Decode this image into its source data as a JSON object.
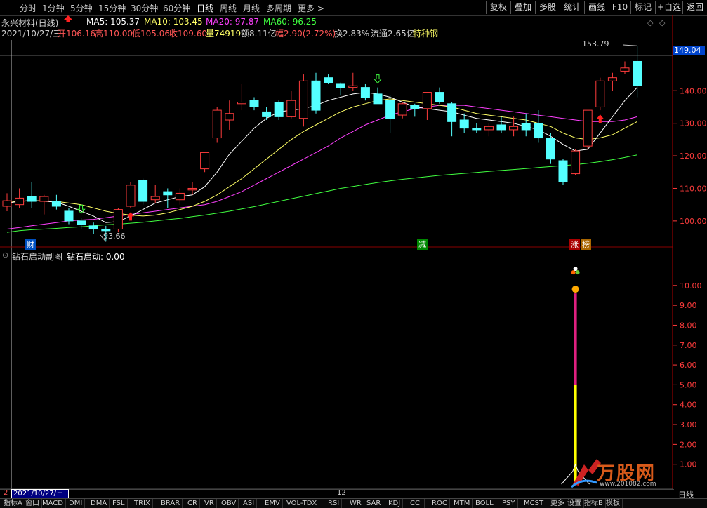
{
  "toolbar": {
    "periods": [
      "分时",
      "1分钟",
      "5分钟",
      "15分钟",
      "30分钟",
      "60分钟",
      "日线",
      "周线",
      "月线",
      "多周期",
      "更多 >"
    ],
    "active_period": "日线",
    "right_buttons": [
      "复权",
      "叠加",
      "多股",
      "统计",
      "画线",
      "F10",
      "标记",
      "+自选",
      "返回"
    ]
  },
  "header": {
    "stock": "永兴材料(日线)",
    "ma5": "MA5: 105.37",
    "ma10": "MA10: 103.45",
    "ma20": "MA20: 97.87",
    "ma60": "MA60: 96.25"
  },
  "quote": {
    "date": "2021/10/27/三",
    "open": "开106.16",
    "high": "高110.00",
    "low": "低105.06",
    "close": "收109.60",
    "volume": "量74919",
    "amount": "额8.11亿",
    "change": "幅2.90(2.72%)",
    "turnover": "换2.83%",
    "float": "流通2.65亿",
    "tag": "特种钢"
  },
  "labels": {
    "high_mark": "153.79",
    "low_mark": "93.66",
    "price_box": "149.04",
    "event_cai": "财",
    "event_jian": "减",
    "event_zhang": "涨",
    "event_bang": "榜",
    "sub_title": "钻石启动副图",
    "sub_value": "钻石启动: 0.00",
    "date_box": "2021/10/27/三",
    "date_mark_left": "2",
    "date_mark_mid": "12",
    "daily_label": "日线",
    "watermark": "万股网",
    "watermark_url": "www.201082.com"
  },
  "bottom_tabs": [
    "指标A",
    "窗口",
    "MACD",
    "DMI",
    "DMA",
    "FSL",
    "TRIX",
    "BRAR",
    "CR",
    "VR",
    "OBV",
    "ASI",
    "EMV",
    "VOL-TDX",
    "RSI",
    "WR",
    "SAR",
    "KDJ",
    "CCI",
    "ROC",
    "MTM",
    "BOLL",
    "PSY",
    "MCST",
    "更多",
    "设置",
    "指标B",
    "模板"
  ],
  "colors": {
    "up": "#ff3c3c",
    "down": "#54ffff",
    "ma5": "#ffffff",
    "ma10": "#ffff66",
    "ma20": "#ff40ff",
    "ma60": "#40ff40",
    "axis": "#ff3c3c"
  },
  "chart_data": [
    {
      "type": "candlestick",
      "y_ticks": [
        100.0,
        110.0,
        120.0,
        130.0,
        140.0
      ],
      "ylim": [
        92,
        156
      ],
      "candles": [
        {
          "o": 104.5,
          "h": 108.5,
          "l": 103.0,
          "c": 106.2
        },
        {
          "o": 105.0,
          "h": 110.0,
          "l": 104.0,
          "c": 107.0
        },
        {
          "o": 107.5,
          "h": 112.0,
          "l": 104.0,
          "c": 106.0
        },
        {
          "o": 106.0,
          "h": 108.0,
          "l": 102.0,
          "c": 107.5
        },
        {
          "o": 106.0,
          "h": 108.0,
          "l": 103.5,
          "c": 104.5
        },
        {
          "o": 103.0,
          "h": 104.0,
          "l": 99.0,
          "c": 100.0
        },
        {
          "o": 100.0,
          "h": 101.0,
          "l": 97.5,
          "c": 99.0
        },
        {
          "o": 98.5,
          "h": 99.5,
          "l": 96.0,
          "c": 97.5
        },
        {
          "o": 97.5,
          "h": 98.5,
          "l": 93.66,
          "c": 97.0
        },
        {
          "o": 97.5,
          "h": 104.0,
          "l": 96.5,
          "c": 103.5
        },
        {
          "o": 104.5,
          "h": 112.0,
          "l": 104.0,
          "c": 111.0
        },
        {
          "o": 112.5,
          "h": 113.0,
          "l": 105.0,
          "c": 106.0
        },
        {
          "o": 106.5,
          "h": 111.0,
          "l": 105.5,
          "c": 107.5
        },
        {
          "o": 109.0,
          "h": 110.0,
          "l": 104.0,
          "c": 108.0
        },
        {
          "o": 106.5,
          "h": 110.0,
          "l": 105.0,
          "c": 108.5
        },
        {
          "o": 109.5,
          "h": 112.0,
          "l": 108.0,
          "c": 110.0
        },
        {
          "o": 116.0,
          "h": 121.0,
          "l": 115.0,
          "c": 121.0
        },
        {
          "o": 125.5,
          "h": 135.0,
          "l": 124.0,
          "c": 134.0
        },
        {
          "o": 131.0,
          "h": 137.0,
          "l": 128.0,
          "c": 133.0
        },
        {
          "o": 136.0,
          "h": 142.0,
          "l": 134.0,
          "c": 136.5
        },
        {
          "o": 137.0,
          "h": 138.0,
          "l": 134.0,
          "c": 135.0
        },
        {
          "o": 133.5,
          "h": 135.0,
          "l": 131.0,
          "c": 132.0
        },
        {
          "o": 136.5,
          "h": 137.0,
          "l": 131.0,
          "c": 132.0
        },
        {
          "o": 132.0,
          "h": 140.0,
          "l": 131.5,
          "c": 137.0
        },
        {
          "o": 131.5,
          "h": 145.0,
          "l": 129.0,
          "c": 143.0
        },
        {
          "o": 143.0,
          "h": 145.5,
          "l": 133.0,
          "c": 134.0
        },
        {
          "o": 144.0,
          "h": 145.0,
          "l": 142.0,
          "c": 142.5
        },
        {
          "o": 142.0,
          "h": 142.5,
          "l": 138.5,
          "c": 141.0
        },
        {
          "o": 141.0,
          "h": 145.5,
          "l": 140.0,
          "c": 141.5
        },
        {
          "o": 141.0,
          "h": 142.0,
          "l": 137.0,
          "c": 138.0
        },
        {
          "o": 139.0,
          "h": 141.0,
          "l": 136.0,
          "c": 136.0
        },
        {
          "o": 137.0,
          "h": 138.5,
          "l": 127.0,
          "c": 131.5
        },
        {
          "o": 132.5,
          "h": 136.5,
          "l": 131.5,
          "c": 136.0
        },
        {
          "o": 135.5,
          "h": 136.0,
          "l": 132.0,
          "c": 134.5
        },
        {
          "o": 134.5,
          "h": 137.5,
          "l": 131.0,
          "c": 139.5
        },
        {
          "o": 139.5,
          "h": 141.0,
          "l": 136.0,
          "c": 136.5
        },
        {
          "o": 136.0,
          "h": 136.5,
          "l": 126.0,
          "c": 130.5
        },
        {
          "o": 131.0,
          "h": 133.0,
          "l": 127.0,
          "c": 128.5
        },
        {
          "o": 128.5,
          "h": 130.0,
          "l": 127.0,
          "c": 128.0
        },
        {
          "o": 128.0,
          "h": 130.0,
          "l": 126.0,
          "c": 129.0
        },
        {
          "o": 129.5,
          "h": 132.0,
          "l": 127.0,
          "c": 128.0
        },
        {
          "o": 128.0,
          "h": 132.0,
          "l": 126.0,
          "c": 129.0
        },
        {
          "o": 130.0,
          "h": 133.0,
          "l": 126.0,
          "c": 128.0
        },
        {
          "o": 130.0,
          "h": 134.0,
          "l": 124.0,
          "c": 125.5
        },
        {
          "o": 125.5,
          "h": 127.0,
          "l": 117.5,
          "c": 119.0
        },
        {
          "o": 118.5,
          "h": 119.0,
          "l": 111.0,
          "c": 112.0
        },
        {
          "o": 114.5,
          "h": 122.0,
          "l": 114.0,
          "c": 121.5
        },
        {
          "o": 123.0,
          "h": 134.0,
          "l": 122.0,
          "c": 134.0
        },
        {
          "o": 135.0,
          "h": 144.0,
          "l": 134.0,
          "c": 143.0
        },
        {
          "o": 143.0,
          "h": 145.5,
          "l": 140.0,
          "c": 144.0
        },
        {
          "o": 146.0,
          "h": 149.0,
          "l": 145.0,
          "c": 147.0
        },
        {
          "o": 149.0,
          "h": 153.79,
          "l": 138.0,
          "c": 141.5
        }
      ],
      "ma5": [
        105.5,
        106.0,
        106.3,
        106.0,
        105.8,
        104.5,
        103.0,
        101.5,
        99.5,
        99.8,
        101.5,
        103.5,
        105.5,
        106.5,
        107.5,
        108.0,
        110.5,
        115.0,
        120.5,
        124.5,
        128.5,
        131.5,
        133.5,
        134.0,
        134.5,
        135.5,
        137.0,
        138.0,
        139.0,
        139.5,
        139.0,
        138.0,
        136.5,
        135.0,
        134.5,
        134.0,
        133.5,
        132.5,
        131.5,
        131.0,
        130.5,
        130.0,
        129.0,
        128.0,
        126.0,
        123.5,
        121.5,
        122.0,
        127.0,
        132.0,
        137.0,
        141.0
      ],
      "ma10": [
        106.0,
        106.0,
        106.2,
        106.2,
        106.0,
        105.5,
        105.0,
        104.0,
        103.0,
        102.3,
        101.8,
        101.5,
        101.8,
        102.5,
        103.5,
        104.5,
        106.0,
        108.0,
        110.5,
        113.0,
        116.0,
        119.0,
        122.0,
        125.0,
        127.5,
        129.5,
        131.5,
        133.5,
        135.0,
        136.0,
        137.0,
        137.5,
        137.0,
        136.5,
        136.0,
        135.5,
        135.0,
        134.0,
        133.0,
        132.5,
        132.0,
        131.5,
        131.0,
        130.0,
        129.0,
        127.0,
        125.5,
        125.0,
        125.5,
        126.5,
        128.5,
        130.5
      ],
      "ma20": [
        97.5,
        98.0,
        98.5,
        99.0,
        99.5,
        100.0,
        100.3,
        100.5,
        101.0,
        101.5,
        102.0,
        102.5,
        103.0,
        103.5,
        104.0,
        104.5,
        105.0,
        106.0,
        107.5,
        109.0,
        111.0,
        113.0,
        115.0,
        117.0,
        119.0,
        121.0,
        123.0,
        125.5,
        127.5,
        129.5,
        131.0,
        132.5,
        133.5,
        134.5,
        135.0,
        135.5,
        135.5,
        135.5,
        135.0,
        134.5,
        134.0,
        133.5,
        133.0,
        132.5,
        132.0,
        131.5,
        131.0,
        130.5,
        130.5,
        130.5,
        131.0,
        132.0
      ],
      "ma60": [
        96.5,
        97.0,
        97.3,
        97.5,
        97.7,
        98.0,
        98.2,
        98.5,
        98.8,
        99.0,
        99.3,
        99.6,
        100.0,
        100.4,
        100.8,
        101.3,
        101.8,
        102.4,
        103.0,
        103.7,
        104.4,
        105.2,
        106.0,
        106.8,
        107.6,
        108.4,
        109.2,
        110.0,
        110.6,
        111.2,
        111.8,
        112.3,
        112.8,
        113.2,
        113.6,
        114.0,
        114.3,
        114.6,
        114.9,
        115.2,
        115.5,
        115.8,
        116.1,
        116.4,
        116.7,
        117.0,
        117.3,
        117.7,
        118.2,
        118.8,
        119.5,
        120.3
      ],
      "markers": {
        "buy_index": [
          10,
          48
        ],
        "sell_index": [
          6,
          30
        ]
      }
    },
    {
      "type": "bar",
      "title": "钻石启动副图",
      "y_ticks": [
        1.0,
        2.0,
        3.0,
        4.0,
        5.0,
        6.0,
        7.0,
        8.0,
        9.0,
        10.0
      ],
      "ylim": [
        0,
        11.3
      ],
      "signal_index": 46,
      "signal_total": 9.6,
      "signal_base": 5.0
    }
  ]
}
